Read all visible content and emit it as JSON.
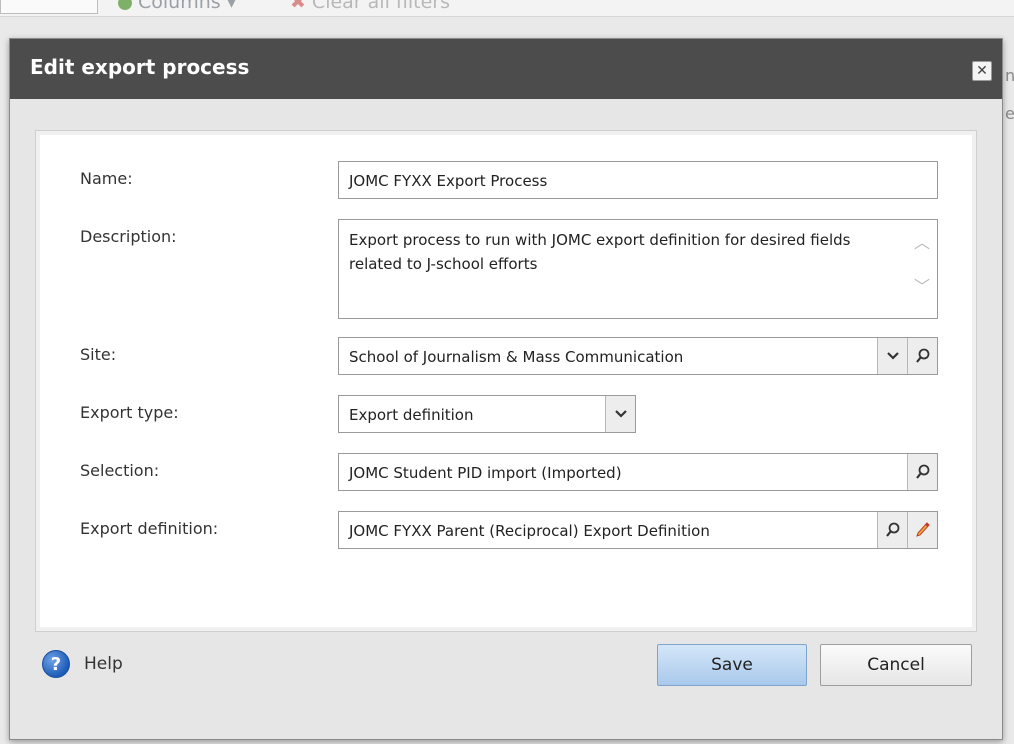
{
  "background": {
    "columns_label": "Columns",
    "clear_filters_label": "Clear all filters",
    "right_char_1": "n",
    "right_char_2": "e"
  },
  "dialog": {
    "title": "Edit export process",
    "close_icon": "close-icon"
  },
  "form": {
    "name": {
      "label": "Name:",
      "value": "JOMC FYXX Export Process"
    },
    "description": {
      "label": "Description:",
      "value": "Export process to run with JOMC export definition for desired fields related to J-school efforts"
    },
    "site": {
      "label": "Site:",
      "value": "School of Journalism & Mass Communication"
    },
    "export_type": {
      "label": "Export type:",
      "value": "Export definition"
    },
    "selection": {
      "label": "Selection:",
      "value": "JOMC Student PID import (Imported)"
    },
    "export_definition": {
      "label": "Export definition:",
      "value": "JOMC FYXX Parent (Reciprocal) Export Definition"
    }
  },
  "footer": {
    "help_label": "Help",
    "save_label": "Save",
    "cancel_label": "Cancel"
  },
  "colors": {
    "titlebar": "#4c4c4c",
    "save_button": "#b9d5f2",
    "help_icon": "#1d5bb8"
  }
}
